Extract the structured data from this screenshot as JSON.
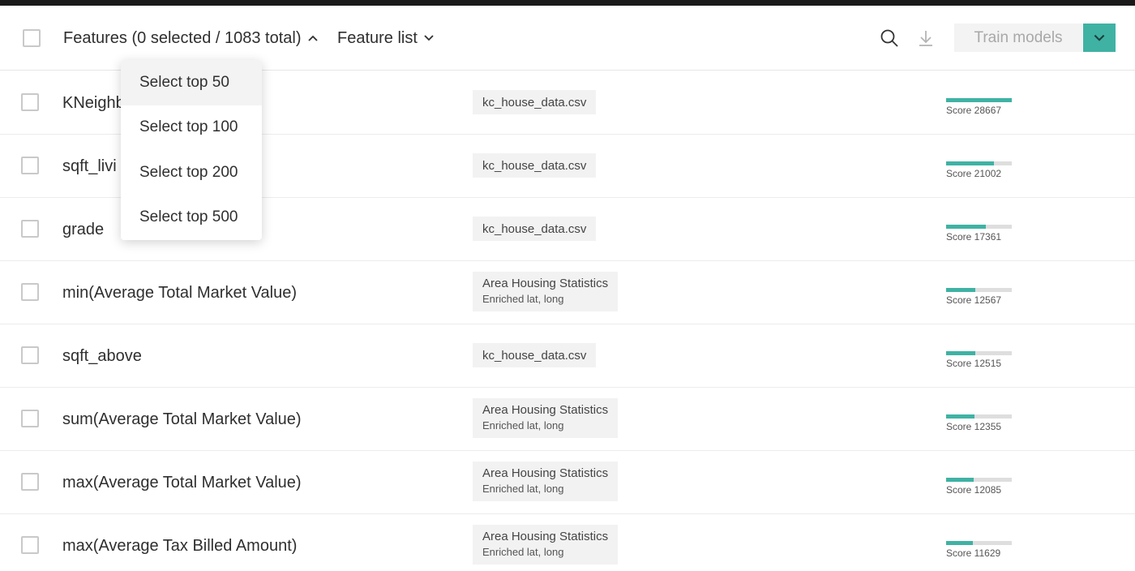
{
  "header": {
    "features_label": "Features (0 selected / 1083 total)",
    "feature_list_label": "Feature list",
    "train_models_label": "Train models"
  },
  "colors": {
    "accent": "#3fb2a4",
    "score_track": "#dedede",
    "source_bg": "#f2f2f2"
  },
  "icons": {
    "search": "search-icon",
    "download": "download-icon",
    "expand": "chevron-up-icon",
    "dropdown": "chevron-down-icon"
  },
  "dropdown": {
    "items": [
      "Select top 50",
      "Select top 100",
      "Select top 200",
      "Select top 500"
    ]
  },
  "rows": [
    {
      "name": "KNeighb",
      "source": "kc_house_data.csv",
      "source_sub": "",
      "score_label": "Score 28667",
      "score_fraction": 1.0
    },
    {
      "name": "sqft_livi",
      "source": "kc_house_data.csv",
      "source_sub": "",
      "score_label": "Score 21002",
      "score_fraction": 0.73
    },
    {
      "name": "grade",
      "source": "kc_house_data.csv",
      "source_sub": "",
      "score_label": "Score 17361",
      "score_fraction": 0.61
    },
    {
      "name": "min(Average Total Market Value)",
      "source": "Area Housing Statistics",
      "source_sub": "Enriched lat, long",
      "score_label": "Score 12567",
      "score_fraction": 0.44
    },
    {
      "name": "sqft_above",
      "source": "kc_house_data.csv",
      "source_sub": "",
      "score_label": "Score 12515",
      "score_fraction": 0.44
    },
    {
      "name": "sum(Average Total Market Value)",
      "source": "Area Housing Statistics",
      "source_sub": "Enriched lat, long",
      "score_label": "Score 12355",
      "score_fraction": 0.43
    },
    {
      "name": "max(Average Total Market Value)",
      "source": "Area Housing Statistics",
      "source_sub": "Enriched lat, long",
      "score_label": "Score 12085",
      "score_fraction": 0.42
    },
    {
      "name": "max(Average Tax Billed Amount)",
      "source": "Area Housing Statistics",
      "source_sub": "Enriched lat, long",
      "score_label": "Score 11629",
      "score_fraction": 0.41
    }
  ]
}
